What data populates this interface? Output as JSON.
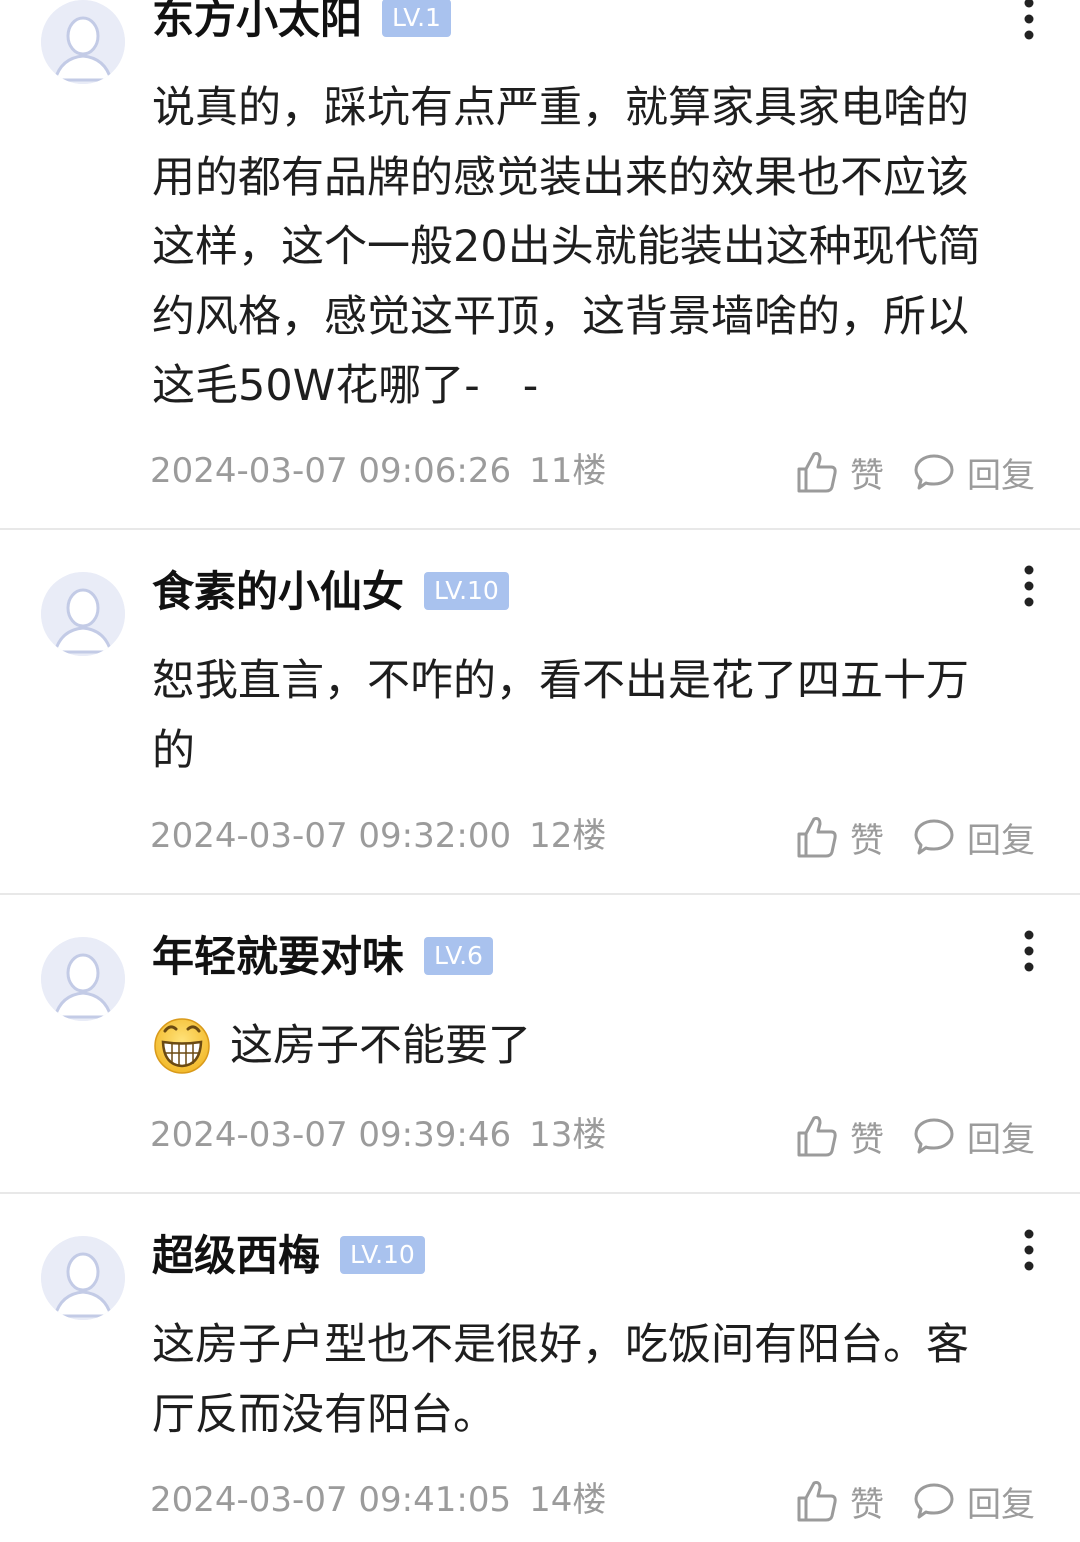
{
  "comments": [
    {
      "username": "东方小太阳",
      "level": "LV.1",
      "lines": [
        "说真的，踩坑有点严重，就算家具家电啥的",
        "用的都有品牌的感觉装出来的效果也不应该",
        "这样，这个一般20出头就能装出这种现代简",
        "约风格，感觉这平顶，这背景墙啥的，所以",
        "这毛50W花哪了-　-"
      ],
      "timestamp": "2024-03-07 09:06:26",
      "floor": "11楼"
    },
    {
      "username": "食素的小仙女",
      "level": "LV.10",
      "lines": [
        "恕我直言，不咋的，看不出是花了四五十万",
        "的"
      ],
      "timestamp": "2024-03-07 09:32:00",
      "floor": "12楼"
    },
    {
      "username": "年轻就要对味",
      "level": "LV.6",
      "lines": [
        "这房子不能要了"
      ],
      "emoji": "grinning-face-emoji",
      "timestamp": "2024-03-07 09:39:46",
      "floor": "13楼"
    },
    {
      "username": "超级西梅",
      "level": "LV.10",
      "lines": [
        "这房子户型也不是很好，吃饭间有阳台。客",
        "厅反而没有阳台。"
      ],
      "timestamp": "2024-03-07 09:41:05",
      "floor": "14楼"
    }
  ],
  "actions": {
    "like_label": "赞",
    "reply_label": "回复"
  },
  "icons": {
    "like": "thumbs-up-icon",
    "reply": "speech-bubble-icon",
    "more": "more-vertical-icon",
    "avatar": "default-avatar-icon"
  },
  "colors": {
    "level_badge": "#a9c2ee",
    "meta_text": "#9b9b9b",
    "divider": "#e8e8e8"
  }
}
